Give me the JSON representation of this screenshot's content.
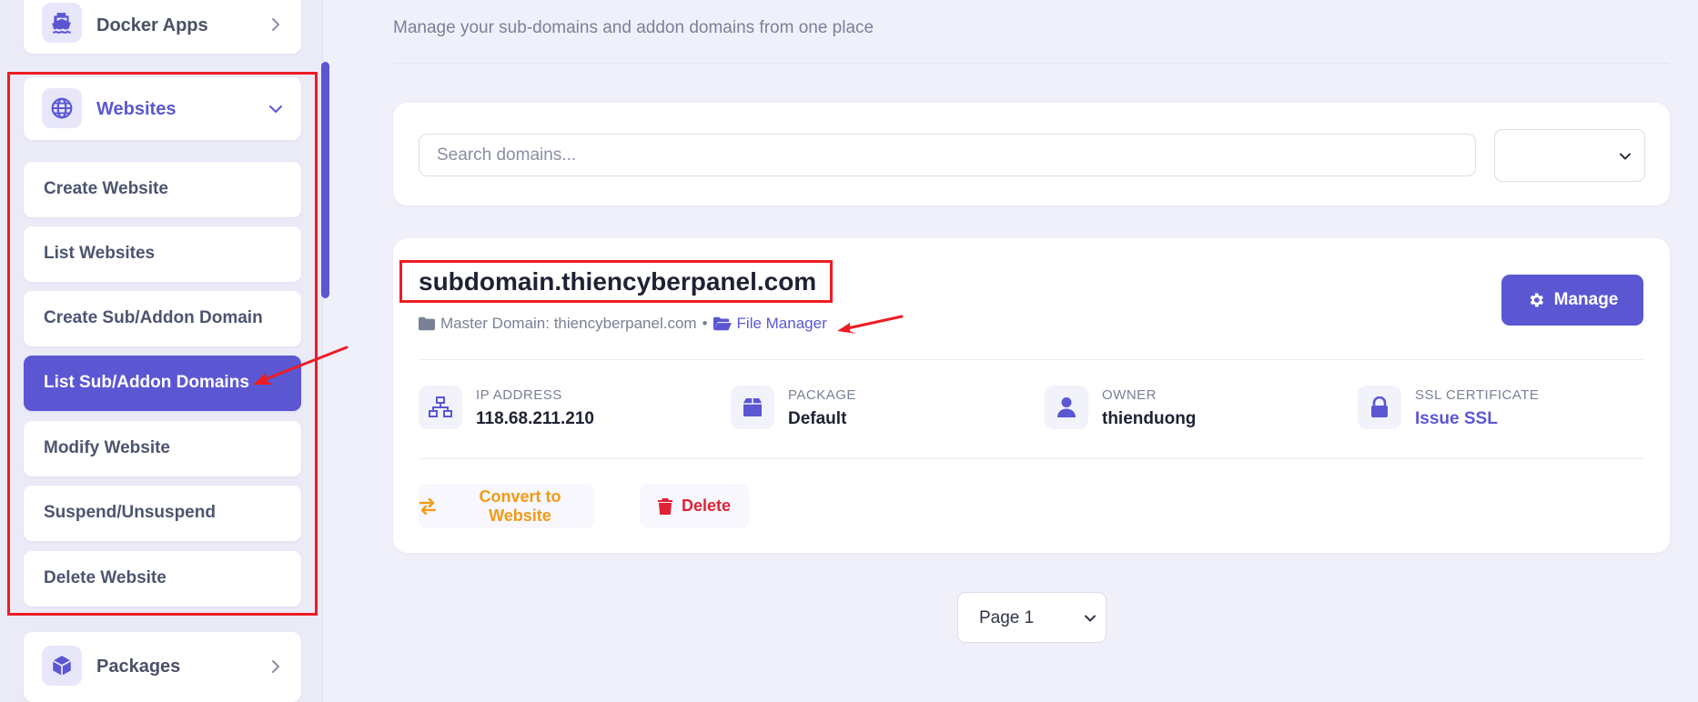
{
  "sidebar": {
    "docker": {
      "label": "Docker Apps",
      "icon": "ship-icon"
    },
    "websites": {
      "label": "Websites",
      "icon": "globe-icon"
    },
    "submenu": [
      {
        "label": "Create Website"
      },
      {
        "label": "List Websites"
      },
      {
        "label": "Create Sub/Addon Domain"
      },
      {
        "label": "List Sub/Addon Domains",
        "active": true
      },
      {
        "label": "Modify Website"
      },
      {
        "label": "Suspend/Unsuspend"
      },
      {
        "label": "Delete Website"
      }
    ],
    "packages": {
      "label": "Packages",
      "icon": "box-icon"
    }
  },
  "main": {
    "subtitle": "Manage your sub-domains and addon domains from one place",
    "search": {
      "placeholder": "Search domains...",
      "value": ""
    },
    "filter": {
      "value": ""
    },
    "domain": {
      "name": "subdomain.thiencyberpanel.com",
      "master_label": "Master Domain: thiencyberpanel.com",
      "separator": "•",
      "file_manager": "File Manager",
      "manage_label": "Manage",
      "info": {
        "ip": {
          "label": "IP ADDRESS",
          "value": "118.68.211.210"
        },
        "package": {
          "label": "PACKAGE",
          "value": "Default"
        },
        "owner": {
          "label": "OWNER",
          "value": "thienduong"
        },
        "ssl": {
          "label": "SSL CERTIFICATE",
          "value": "Issue SSL"
        }
      },
      "actions": {
        "convert": "Convert to Website",
        "delete": "Delete"
      }
    },
    "pagination": {
      "selected": "Page 1"
    }
  },
  "colors": {
    "accent": "#5b57d3",
    "background": "#f0f0fb",
    "annotation": "#ee1c24",
    "convert": "#f29a16",
    "delete": "#e02236"
  }
}
